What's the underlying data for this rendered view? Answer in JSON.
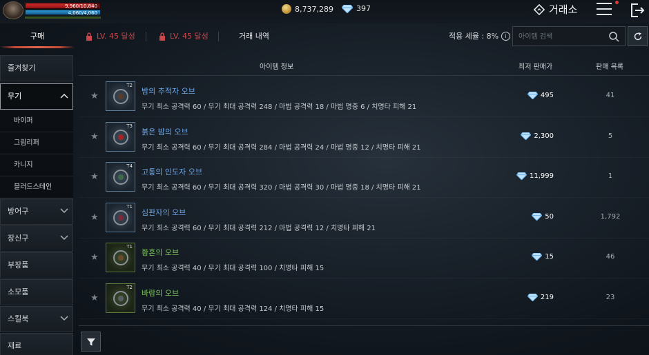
{
  "player": {
    "hp_text": "9,960/10,840",
    "hp_fraction": 0.92,
    "mp_text": "4,060/4,060",
    "mp_fraction": 1.0
  },
  "currency": {
    "gold": "8,737,289",
    "diamonds": "397"
  },
  "header": {
    "exchange_title": "거래소"
  },
  "tabs": [
    {
      "label": "구매",
      "active": true
    },
    {
      "label": "LV. 45 달성",
      "locked": true
    },
    {
      "label": "LV. 45 달성",
      "locked": true
    },
    {
      "label": "거래 내역"
    }
  ],
  "tax": {
    "label": "적용 세율 : 8%"
  },
  "search": {
    "placeholder": "아이템 검색"
  },
  "sidebar": {
    "items": [
      {
        "label": "즐겨찾기"
      },
      {
        "label": "무기",
        "expanded": true
      },
      {
        "label": "방어구"
      },
      {
        "label": "장신구"
      },
      {
        "label": "부장품"
      },
      {
        "label": "소모품"
      },
      {
        "label": "스킬북"
      },
      {
        "label": "재료"
      }
    ],
    "sub_items": [
      {
        "label": "바이퍼"
      },
      {
        "label": "그림리퍼"
      },
      {
        "label": "카니지"
      },
      {
        "label": "블러드스테인"
      }
    ]
  },
  "table": {
    "headers": {
      "info": "아이템 정보",
      "price": "최저 판매가",
      "count": "판매 목록"
    },
    "rows": [
      {
        "tier": "T2",
        "name": "밤의 추적자 오브",
        "grade": "blue",
        "core": "#5a3a2a",
        "desc": "무기 최소 공격력 60 / 무기 최대 공격력 248 / 마법 공격력 18 / 마법 명중 6 / 치명타 피해 21",
        "price": "495",
        "count": "41"
      },
      {
        "tier": "T3",
        "name": "붉은 밤의 오브",
        "grade": "blue",
        "core": "#a82424",
        "desc": "무기 최소 공격력 60 / 무기 최대 공격력 284 / 마법 공격력 24 / 마법 명중 12 / 치명타 피해 21",
        "price": "2,300",
        "count": "5"
      },
      {
        "tier": "T4",
        "name": "고통의 인도자 오브",
        "grade": "blue",
        "core": "#3e6a4a",
        "desc": "무기 최소 공격력 60 / 무기 최대 공격력 320 / 마법 공격력 30 / 마법 명중 18 / 치명타 피해 21",
        "price": "11,999",
        "count": "1"
      },
      {
        "tier": "T1",
        "name": "심판자의 오브",
        "grade": "blue",
        "core": "#7a2a3a",
        "desc": "무기 최소 공격력 60 / 무기 최대 공격력 212 / 마법 공격력 12 / 치명타 피해 21",
        "price": "50",
        "count": "1,792"
      },
      {
        "tier": "T1",
        "name": "황혼의 오브",
        "grade": "green",
        "core": "#6a4a2a",
        "desc": "무기 최소 공격력 40 / 무기 최대 공격력 100 / 치명타 피해 15",
        "price": "15",
        "count": "46"
      },
      {
        "tier": "T2",
        "name": "바람의 오브",
        "grade": "green",
        "core": "#5a5f64",
        "desc": "무기 최소 공격력 40 / 무기 최대 공격력 124 / 치명타 피해 15",
        "price": "219",
        "count": "23"
      }
    ]
  },
  "colors": {
    "accent": "#e0664f",
    "blue_item": "#6ea6e6",
    "green_item": "#7cc35b",
    "locked": "#c9474a"
  }
}
